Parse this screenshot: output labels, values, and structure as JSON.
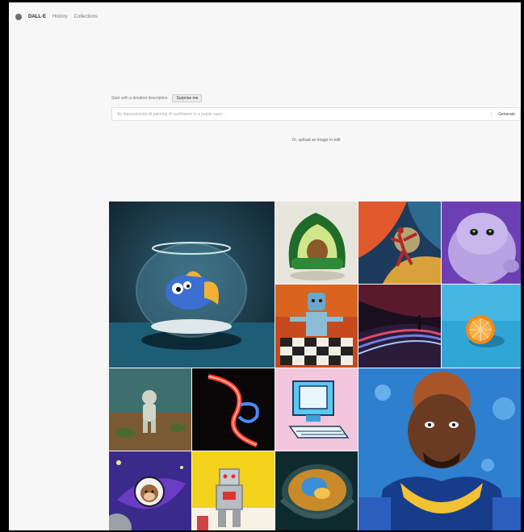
{
  "nav": {
    "brand": "DALL·E",
    "links": [
      "History",
      "Collections"
    ]
  },
  "prompt": {
    "intro": "Start with a detailed description",
    "surprise_label": "Surprise me",
    "placeholder": "An Impressionist oil painting of sunflowers in a purple vase...",
    "generate_label": "Generate",
    "upload_label": "Or, upload an image to edit"
  },
  "gallery": {
    "items": [
      {
        "subject": "fish in a fishbowl"
      },
      {
        "subject": "avocado armchair"
      },
      {
        "subject": "cosmic dancer painting"
      },
      {
        "subject": "purple furry monster"
      },
      {
        "subject": "robot playing chess"
      },
      {
        "subject": "light trail road"
      },
      {
        "subject": "orange half on blue"
      },
      {
        "subject": "astronaut in desert"
      },
      {
        "subject": "neon light sculpture"
      },
      {
        "subject": "retro computer"
      },
      {
        "subject": "football player portrait"
      },
      {
        "subject": "monkey astronaut"
      },
      {
        "subject": "toy robot"
      },
      {
        "subject": "bowl of soup galaxy"
      }
    ]
  },
  "colors": {
    "page_bg": "#f7f7f8",
    "frame": "#000000"
  }
}
